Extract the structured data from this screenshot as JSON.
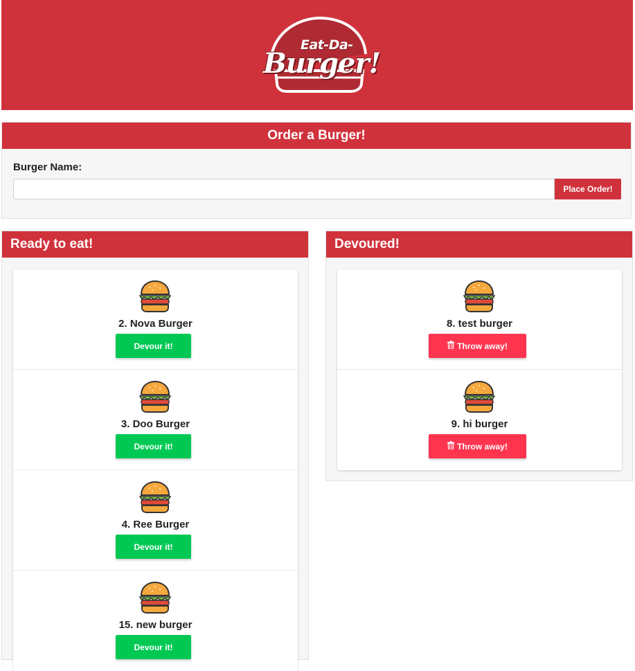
{
  "header": {
    "logo_top": "Eat-Da-",
    "logo_main": "Burger!"
  },
  "order": {
    "title": "Order a Burger!",
    "field_label": "Burger Name:",
    "input_value": "",
    "input_placeholder": "",
    "button_label": "Place Order!"
  },
  "ready": {
    "title": "Ready to eat!",
    "button_label": "Devour it!",
    "items": [
      {
        "name": "2. Nova Burger"
      },
      {
        "name": "3. Doo Burger"
      },
      {
        "name": "4. Ree Burger"
      },
      {
        "name": "15. new burger"
      }
    ]
  },
  "devoured": {
    "title": "Devoured!",
    "button_label": "Throw away!",
    "button_icon": "trash-icon",
    "items": [
      {
        "name": "8. test burger"
      },
      {
        "name": "9. hi burger"
      }
    ]
  },
  "colors": {
    "brand_red": "#d0323c",
    "devour_green": "#00c853",
    "throw_red": "#ff3550"
  }
}
